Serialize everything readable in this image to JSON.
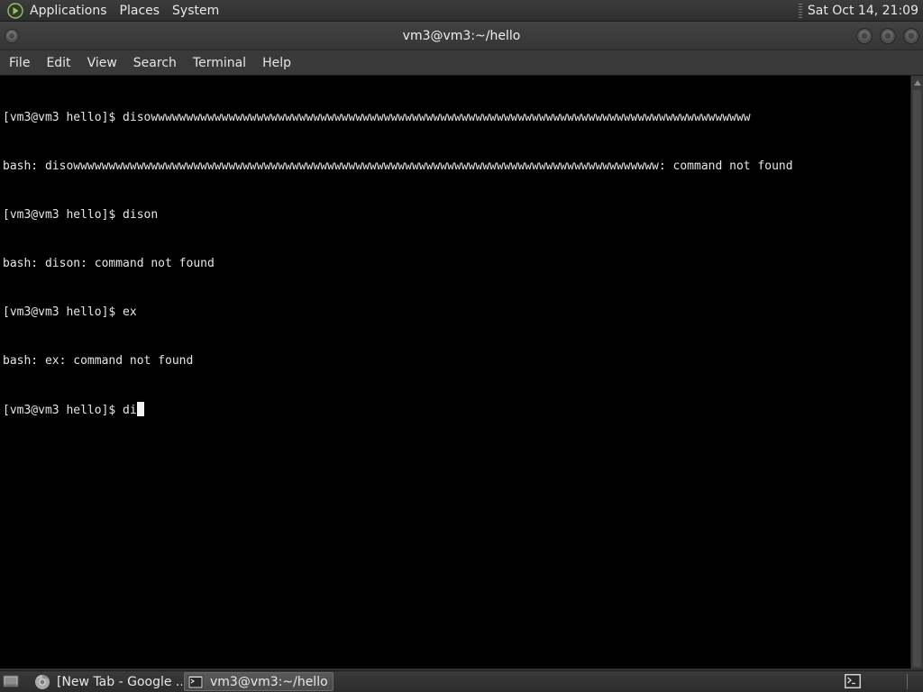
{
  "top_panel": {
    "menus": [
      "Applications",
      "Places",
      "System"
    ],
    "clock": "Sat Oct 14, 21:09"
  },
  "window": {
    "title": "vm3@vm3:~/hello"
  },
  "menubar": {
    "items": [
      "File",
      "Edit",
      "View",
      "Search",
      "Terminal",
      "Help"
    ]
  },
  "terminal": {
    "lines": [
      "[vm3@vm3 hello]$ disowwwwwwwwwwwwwwwwwwwwwwwwwwwwwwwwwwwwwwwwwwwwwwwwwwwwwwwwwwwwwwwwwwwwwwwwwwwwwwwwwwwww",
      "bash: disowwwwwwwwwwwwwwwwwwwwwwwwwwwwwwwwwwwwwwwwwwwwwwwwwwwwwwwwwwwwwwwwwwwwwwwwwwwwwwwwwww: command not found",
      "[vm3@vm3 hello]$ dison",
      "bash: dison: command not found",
      "[vm3@vm3 hello]$ ex",
      "bash: ex: command not found"
    ],
    "current_prompt": "[vm3@vm3 hello]$ di"
  },
  "taskbar": {
    "tasks": [
      {
        "label": "[New Tab - Google ...",
        "icon": "chrome-icon",
        "active": false
      },
      {
        "label": "vm3@vm3:~/hello",
        "icon": "terminal-icon",
        "active": true
      }
    ]
  },
  "colors": {
    "terminal_bg": "#000000",
    "terminal_fg": "#e6e6e6",
    "panel_bg": "#333333"
  }
}
